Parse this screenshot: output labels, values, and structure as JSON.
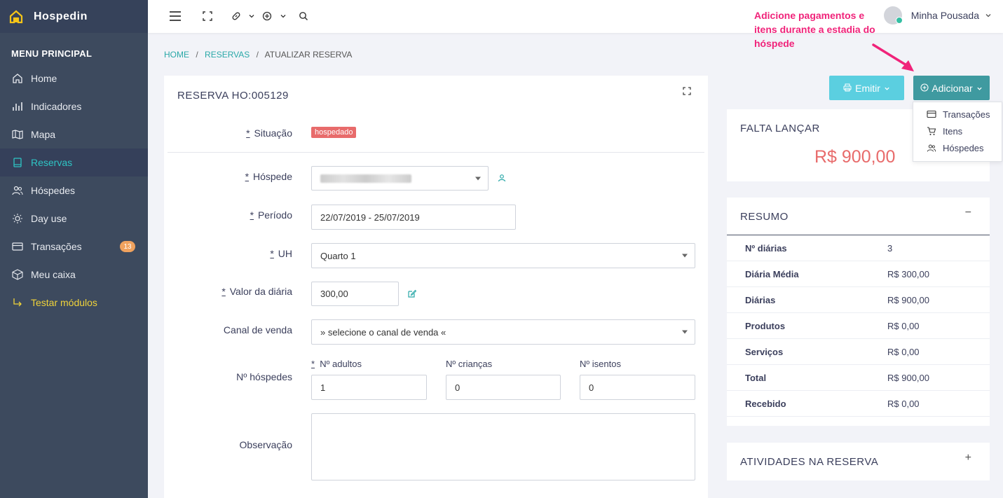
{
  "sidebar": {
    "brand": "Hospedin",
    "menu_title": "MENU PRINCIPAL",
    "items": [
      {
        "label": "Home",
        "icon": "home-icon"
      },
      {
        "label": "Indicadores",
        "icon": "bar-chart-icon"
      },
      {
        "label": "Mapa",
        "icon": "map-icon"
      },
      {
        "label": "Reservas",
        "icon": "tablet-icon"
      },
      {
        "label": "Hóspedes",
        "icon": "users-icon"
      },
      {
        "label": "Day use",
        "icon": "sun-icon"
      },
      {
        "label": "Transações",
        "icon": "credit-card-icon",
        "badge": "13"
      },
      {
        "label": "Meu caixa",
        "icon": "box-icon"
      },
      {
        "label": "Testar módulos",
        "icon": "arrow-corner-icon"
      }
    ],
    "active_index": 3
  },
  "topbar": {
    "user_name": "Minha Pousada"
  },
  "annotation": "Adicione pagamentos e itens durante a estadia do hóspede",
  "breadcrumb": {
    "home": "HOME",
    "reservas": "RESERVAS",
    "current": "ATUALIZAR RESERVA",
    "sep": "/"
  },
  "form": {
    "title": "RESERVA HO:005129",
    "situacao_label": "Situação",
    "situacao_value": "hospedado",
    "hospede_label": "Hóspede",
    "periodo_label": "Período",
    "periodo_value": "22/07/2019 - 25/07/2019",
    "uh_label": "UH",
    "uh_value": "Quarto 1",
    "valor_label": "Valor da diária",
    "valor_value": "300,00",
    "canal_label": "Canal de venda",
    "canal_value": "» selecione o canal de venda «",
    "hospedes_label": "Nº hóspedes",
    "adultos_label": "Nº adultos",
    "adultos_value": "1",
    "criancas_label": "Nº crianças",
    "criancas_value": "0",
    "isentos_label": "Nº isentos",
    "isentos_value": "0",
    "observacao_label": "Observação",
    "required_mark": "*"
  },
  "actions": {
    "emitir": "Emitir",
    "adicionar": "Adicionar",
    "dropdown": [
      {
        "label": "Transações",
        "icon": "credit-card-icon"
      },
      {
        "label": "Itens",
        "icon": "cart-icon"
      },
      {
        "label": "Hóspedes",
        "icon": "users-icon"
      }
    ]
  },
  "falta": {
    "title": "FALTA LANÇAR",
    "value": "R$ 900,00"
  },
  "resumo": {
    "title": "RESUMO",
    "toggle": "−",
    "rows": [
      {
        "k": "Nº diárias",
        "v": "3"
      },
      {
        "k": "Diária Média",
        "v": "R$ 300,00"
      },
      {
        "k": "Diárias",
        "v": "R$ 900,00"
      },
      {
        "k": "Produtos",
        "v": "R$ 0,00"
      },
      {
        "k": "Serviços",
        "v": "R$ 0,00"
      },
      {
        "k": "Total",
        "v": "R$ 900,00"
      },
      {
        "k": "Recebido",
        "v": "R$ 0,00"
      }
    ]
  },
  "atividades": {
    "title": "ATIVIDADES NA RESERVA",
    "toggle": "+"
  },
  "colors": {
    "sidebar": "#3d4a5e",
    "accent": "#2aa8a8",
    "badge": "#e86b6b",
    "annotation": "#f0237a"
  }
}
